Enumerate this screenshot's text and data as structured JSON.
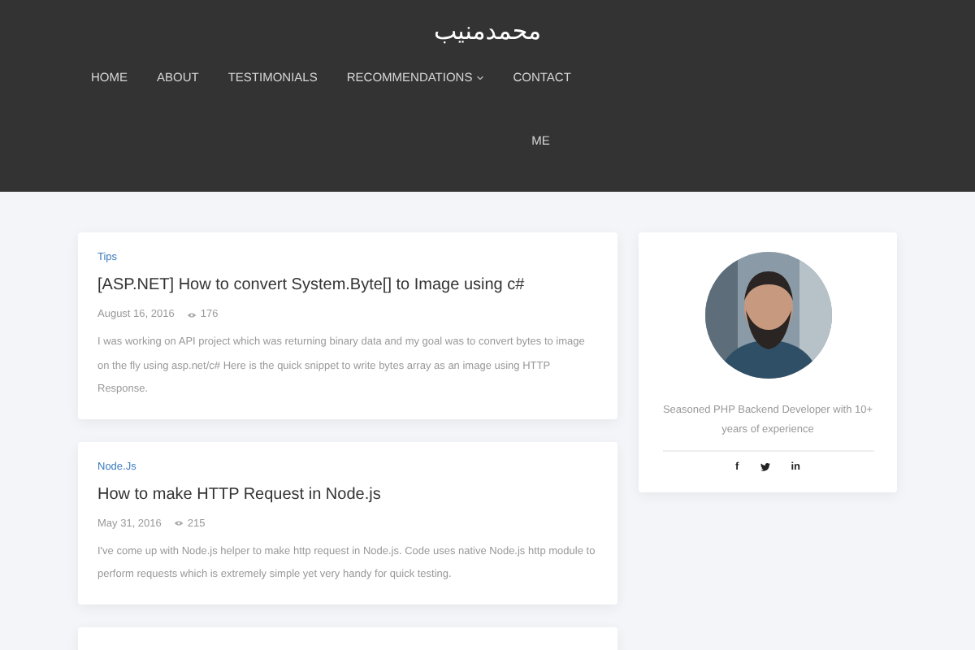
{
  "site": {
    "logo": "محمدمنیب"
  },
  "nav": [
    {
      "label": "HOME",
      "dropdown": false
    },
    {
      "label": "ABOUT",
      "dropdown": false
    },
    {
      "label": "TESTIMONIALS",
      "dropdown": false
    },
    {
      "label": "RECOMMENDATIONS",
      "dropdown": true
    },
    {
      "label": "CONTACT ME",
      "dropdown": false
    }
  ],
  "posts": [
    {
      "kind": "post",
      "category": "Tips",
      "title": "[ASP.NET] How to convert System.Byte[] to Image using c#",
      "date": "August 16, 2016",
      "views": "176",
      "excerpt": "I was working on API project which was returning binary data and my goal was to convert bytes to image on the fly using asp.net/c# Here is the quick snippet to write bytes array as an image using HTTP Response."
    },
    {
      "kind": "post",
      "category": "Node.Js",
      "title": "How to make HTTP Request in Node.js",
      "date": "May 31, 2016",
      "views": "215",
      "excerpt": "I've come up with Node.js helper to make http request in Node.js. Code uses native Node.js http module to perform requests which is extremely simple yet very handy for quick testing."
    },
    {
      "kind": "placeholder"
    }
  ],
  "profile": {
    "bio": "Seasoned PHP Backend Developer with 10+ years of experience",
    "social": [
      {
        "kind": "text",
        "label": "f"
      },
      {
        "kind": "bird"
      },
      {
        "kind": "text",
        "label": "in"
      }
    ]
  }
}
